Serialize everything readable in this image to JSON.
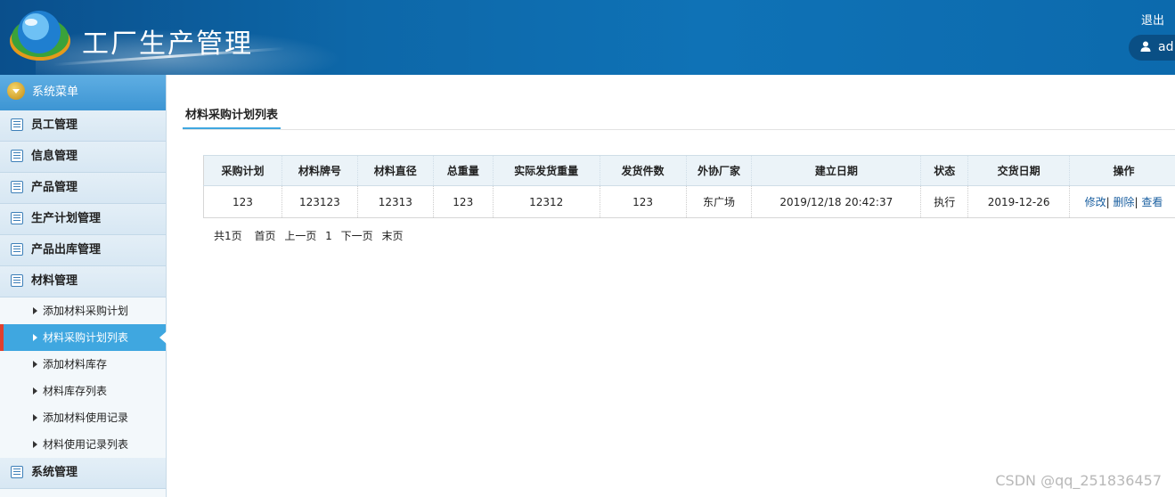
{
  "header": {
    "title": "工厂生产管理",
    "logout_label": "退出",
    "user_label": "ad"
  },
  "sidebar": {
    "menu_title": "系统菜单",
    "categories": [
      {
        "label": "员工管理"
      },
      {
        "label": "信息管理"
      },
      {
        "label": "产品管理"
      },
      {
        "label": "生产计划管理"
      },
      {
        "label": "产品出库管理"
      },
      {
        "label": "材料管理"
      }
    ],
    "subitems": [
      {
        "label": "添加材料采购计划"
      },
      {
        "label": "材料采购计划列表"
      },
      {
        "label": "添加材料库存"
      },
      {
        "label": "材料库存列表"
      },
      {
        "label": "添加材料使用记录"
      },
      {
        "label": "材料使用记录列表"
      }
    ],
    "last_category": {
      "label": "系统管理"
    }
  },
  "main": {
    "page_tab": "材料采购计划列表",
    "table": {
      "headers": [
        "采购计划",
        "材料牌号",
        "材料直径",
        "总重量",
        "实际发货重量",
        "发货件数",
        "外协厂家",
        "建立日期",
        "状态",
        "交货日期",
        "操作"
      ],
      "rows": [
        {
          "cells": [
            "123",
            "123123",
            "12313",
            "123",
            "12312",
            "123",
            "东广场",
            "2019/12/18 20:42:37",
            "执行",
            "2019-12-26"
          ],
          "actions": {
            "edit": "修改",
            "delete": "删除",
            "view": "查看",
            "sep": "|"
          }
        }
      ]
    },
    "pager": {
      "total": "共1页",
      "first": "首页",
      "prev": "上一页",
      "current": "1",
      "next": "下一页",
      "last": "末页"
    }
  },
  "watermark": "CSDN @qq_251836457",
  "colors": {
    "header_blue": "#0d67a8",
    "active_item": "#3fa7e0",
    "active_marker": "#e0402e",
    "link": "#1a5fa0"
  }
}
